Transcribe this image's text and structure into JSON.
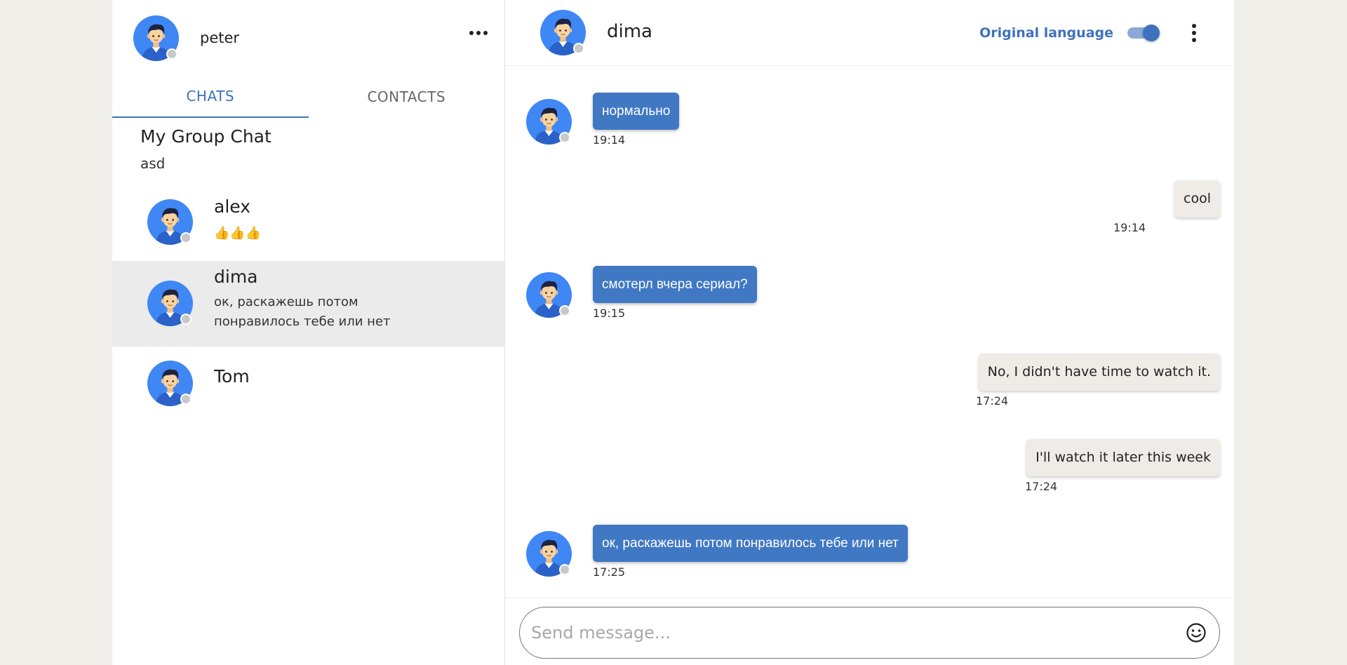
{
  "colors": {
    "accent": "#3e72bd",
    "incoming_bubble": "#4078c4",
    "outgoing_bubble": "#efece7",
    "avatar_bg": "#3f87f5",
    "status_offline": "#c8c8c8",
    "selected_row": "#ebebeb"
  },
  "sidebar": {
    "user_name": "peter",
    "menu_icon": "more-horizontal-icon",
    "tabs": [
      {
        "label": "CHATS",
        "active": true
      },
      {
        "label": "CONTACTS",
        "active": false
      }
    ],
    "group": {
      "name": "My Group Chat",
      "last_message": "asd"
    },
    "chats": [
      {
        "name": "alex",
        "last_line1": "👍👍👍",
        "last_line2": ""
      },
      {
        "name": "dima",
        "last_line1": "ок, раскажешь потом",
        "last_line2": "понравилось тебе или нет",
        "selected": true
      },
      {
        "name": "Tom",
        "last_line1": "",
        "last_line2": ""
      }
    ]
  },
  "chat": {
    "title": "dima",
    "language_label": "Original language",
    "language_toggle_on": true,
    "messages": [
      {
        "direction": "in",
        "text": "нормально",
        "time": "19:14"
      },
      {
        "direction": "out",
        "text": "cool",
        "time": "19:14"
      },
      {
        "direction": "in",
        "text": "смотерл вчера сериал?",
        "time": "19:15"
      },
      {
        "direction": "out",
        "text": "No, I didn't have time to watch it.",
        "time": "17:24"
      },
      {
        "direction": "out",
        "text": "I'll watch it later this week",
        "time": "17:24"
      },
      {
        "direction": "in",
        "text": "ок, раскажешь потом понравилось тебе или нет",
        "time": "17:25"
      }
    ],
    "composer": {
      "placeholder": "Send message...",
      "value": "",
      "emoji_icon": "smile-icon"
    }
  }
}
